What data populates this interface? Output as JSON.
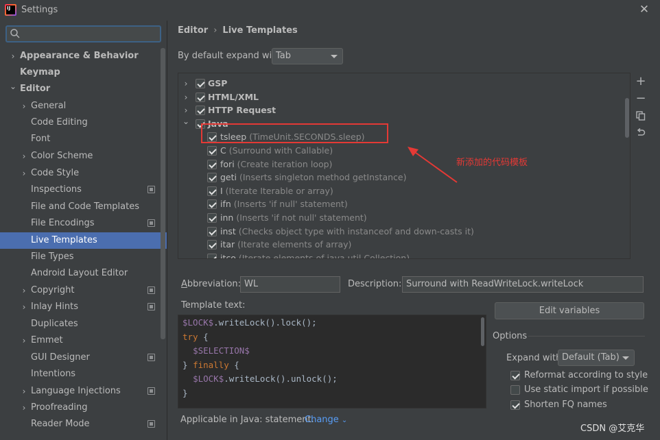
{
  "window": {
    "title": "Settings",
    "close_icon": "close-icon",
    "app_icon_text": "IJ"
  },
  "sidebar": {
    "search": {
      "value": "",
      "placeholder": ""
    },
    "items": [
      {
        "label": "Appearance & Behavior",
        "bold": true,
        "expander": "collapsed"
      },
      {
        "label": "Keymap",
        "bold": true
      },
      {
        "label": "Editor",
        "bold": true,
        "expander": "expanded"
      },
      {
        "label": "General",
        "expander": "collapsed"
      },
      {
        "label": "Code Editing"
      },
      {
        "label": "Font"
      },
      {
        "label": "Color Scheme",
        "expander": "collapsed"
      },
      {
        "label": "Code Style",
        "expander": "collapsed"
      },
      {
        "label": "Inspections",
        "project": true
      },
      {
        "label": "File and Code Templates"
      },
      {
        "label": "File Encodings",
        "project": true
      },
      {
        "label": "Live Templates",
        "selected": true
      },
      {
        "label": "File Types"
      },
      {
        "label": "Android Layout Editor"
      },
      {
        "label": "Copyright",
        "expander": "collapsed",
        "project": true
      },
      {
        "label": "Inlay Hints",
        "expander": "collapsed",
        "project": true
      },
      {
        "label": "Duplicates"
      },
      {
        "label": "Emmet",
        "expander": "collapsed"
      },
      {
        "label": "GUI Designer",
        "project": true
      },
      {
        "label": "Intentions"
      },
      {
        "label": "Language Injections",
        "expander": "collapsed",
        "project": true
      },
      {
        "label": "Proofreading",
        "expander": "collapsed"
      },
      {
        "label": "Reader Mode",
        "project": true
      }
    ]
  },
  "breadcrumb": {
    "parent": "Editor",
    "separator": "›",
    "current": "Live Templates"
  },
  "expand": {
    "label": "By default expand with",
    "value": "Tab"
  },
  "templates": [
    {
      "name": "GSP",
      "group": true,
      "expander": "collapsed"
    },
    {
      "name": "HTML/XML",
      "group": true,
      "expander": "collapsed"
    },
    {
      "name": "HTTP Request",
      "group": true,
      "expander": "collapsed"
    },
    {
      "name": "Java",
      "group": true,
      "expander": "expanded"
    },
    {
      "name": "tsleep",
      "desc": "(TimeUnit.SECONDS.sleep)"
    },
    {
      "name": "C",
      "desc": "(Surround with Callable)"
    },
    {
      "name": "fori",
      "desc": "(Create iteration loop)"
    },
    {
      "name": "geti",
      "desc": "(Inserts singleton method getInstance)"
    },
    {
      "name": "I",
      "desc": "(Iterate Iterable or array)"
    },
    {
      "name": "ifn",
      "desc": "(Inserts 'if null' statement)"
    },
    {
      "name": "inn",
      "desc": "(Inserts 'if not null' statement)"
    },
    {
      "name": "inst",
      "desc": "(Checks object type with instanceof and down-casts it)"
    },
    {
      "name": "itar",
      "desc": "(Iterate elements of array)"
    },
    {
      "name": "itco",
      "desc": "(Iterate elements of java.util.Collection)"
    }
  ],
  "annotation": {
    "text": "新添加的代码模板",
    "color": "#e53935"
  },
  "toolbar": {
    "add": "+",
    "remove": "−",
    "copy_icon": "copy-icon",
    "restore_icon": "restore-icon"
  },
  "abbreviation": {
    "label": "Abbreviation:",
    "value": "WL"
  },
  "description": {
    "label": "Description:",
    "value": "Surround with ReadWriteLock.writeLock"
  },
  "template_text": {
    "label": "Template text:",
    "lines": [
      [
        {
          "t": "$LOCK$",
          "c": "var"
        },
        {
          "t": ".writeLock().lock();",
          "c": "tx"
        }
      ],
      [
        {
          "t": "try",
          "c": "kw"
        },
        {
          "t": " {",
          "c": "tx"
        }
      ],
      [
        {
          "t": "  ",
          "c": "tx"
        },
        {
          "t": "$SELECTION$",
          "c": "var"
        }
      ],
      [
        {
          "t": "} ",
          "c": "tx"
        },
        {
          "t": "finally",
          "c": "kw"
        },
        {
          "t": " {",
          "c": "tx"
        }
      ],
      [
        {
          "t": "  ",
          "c": "tx"
        },
        {
          "t": "$LOCK$",
          "c": "var"
        },
        {
          "t": ".writeLock().unlock();",
          "c": "tx"
        }
      ],
      [
        {
          "t": "}",
          "c": "tx"
        }
      ]
    ]
  },
  "edit_variables": "Edit variables",
  "options": {
    "title": "Options",
    "expand_with_label": "Expand with",
    "expand_with_value": "Default (Tab)",
    "checks": [
      {
        "label": "Reformat according to style",
        "checked": true
      },
      {
        "label": "Use static import if possible",
        "checked": false
      },
      {
        "label": "Shorten FQ names",
        "checked": true
      }
    ]
  },
  "applicable": {
    "text": "Applicable in Java: statement.",
    "change": "Change"
  },
  "watermark": "CSDN @艾克华"
}
